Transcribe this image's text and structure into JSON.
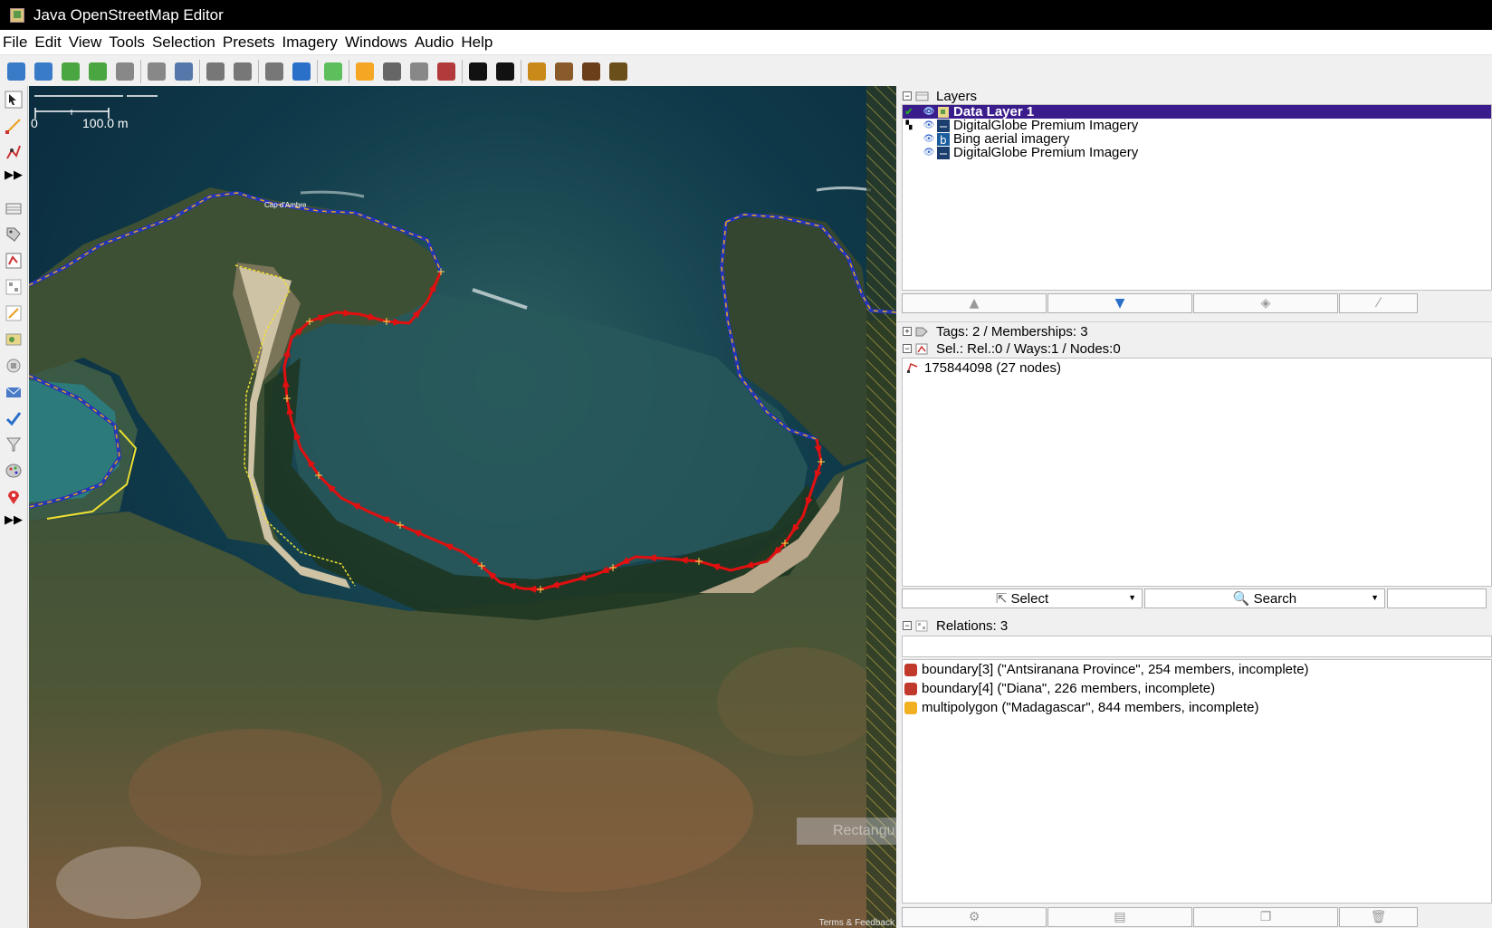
{
  "window": {
    "title": "Java OpenStreetMap Editor"
  },
  "menu": [
    "File",
    "Edit",
    "View",
    "Tools",
    "Selection",
    "Presets",
    "Imagery",
    "Windows",
    "Audio",
    "Help"
  ],
  "toolbar": {
    "buttons": [
      {
        "icon": "open-icon",
        "color": "#3a7bc8"
      },
      {
        "icon": "save-icon",
        "color": "#3a7bc8"
      },
      {
        "icon": "download-icon",
        "color": "#4aa640"
      },
      {
        "icon": "upload-icon",
        "color": "#4aa640"
      },
      {
        "icon": "undo-icon",
        "color": "#888888"
      },
      {
        "icon": "redo-icon",
        "color": "#888888"
      },
      {
        "icon": "zoom-icon",
        "color": "#5577aa"
      },
      {
        "icon": "preferences-icon",
        "color": "#777777"
      },
      {
        "icon": "split-way-icon",
        "color": "#777777"
      },
      {
        "icon": "combine-way-icon",
        "color": "#777777"
      },
      {
        "icon": "update-data-icon",
        "color": "#2a6fc8"
      },
      {
        "icon": "imagery-icon",
        "color": "#5cbf5c"
      },
      {
        "icon": "road-icon",
        "color": "#f5a623"
      },
      {
        "icon": "track-icon",
        "color": "#666666"
      },
      {
        "icon": "railway-icon",
        "color": "#888888"
      },
      {
        "icon": "building-icon",
        "color": "#b23a3a"
      },
      {
        "icon": "car-icon",
        "color": "#111111"
      },
      {
        "icon": "bus-icon",
        "color": "#111111"
      },
      {
        "icon": "hazard-icon",
        "color": "#c98a1a"
      },
      {
        "icon": "restaurant-icon",
        "color": "#8a5a2a"
      },
      {
        "icon": "castle-icon",
        "color": "#6b3f1a"
      },
      {
        "icon": "industrial-icon",
        "color": "#6b4f1a"
      }
    ]
  },
  "map": {
    "scale_label": "100.0 m",
    "scale_zero": "0",
    "place_label": "Cap d'Ambre",
    "attribution": "Terms & Feedback",
    "watermark": "Rectangular Snip"
  },
  "layers": {
    "title": "Layers",
    "items": [
      {
        "name": "Data Layer 1",
        "active": true
      },
      {
        "name": "DigitalGlobe Premium Imagery",
        "active": false
      },
      {
        "name": "Bing aerial imagery",
        "active": false
      },
      {
        "name": "DigitalGlobe Premium Imagery",
        "active": false
      }
    ]
  },
  "tags": {
    "title": "Tags: 2 / Memberships: 3"
  },
  "selection": {
    "title": "Sel.: Rel.:0 / Ways:1 / Nodes:0",
    "items": [
      "175844098 (27 nodes)"
    ],
    "select_label": "Select",
    "search_label": "Search"
  },
  "relations": {
    "title": "Relations: 3",
    "items": [
      {
        "text": "boundary[3] (\"Antsiranana Province\", 254 members, incomplete)",
        "color": "#c0392b"
      },
      {
        "text": "boundary[4] (\"Diana\", 226 members, incomplete)",
        "color": "#c0392b"
      },
      {
        "text": "multipolygon (\"Madagascar\", 844 members, incomplete)",
        "color": "#f0b020"
      }
    ]
  }
}
